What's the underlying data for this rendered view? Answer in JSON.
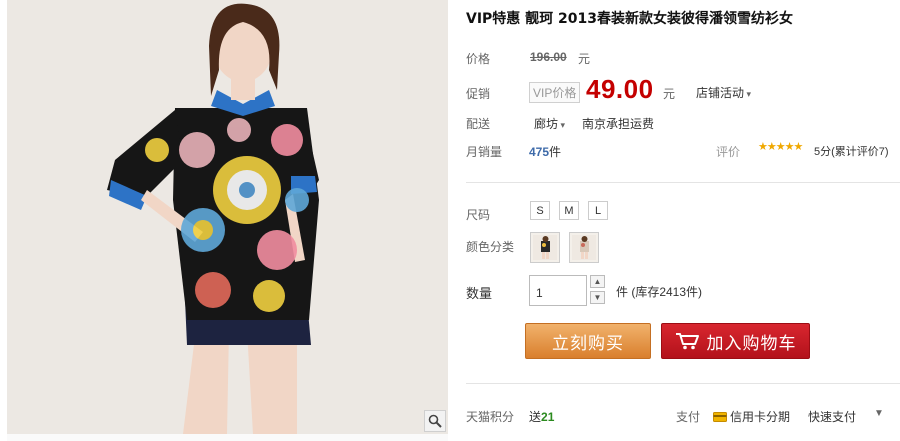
{
  "product": {
    "title": "VIP特惠 靓珂 2013春装新款女装彼得潘领雪纺衫女"
  },
  "price": {
    "label": "价格",
    "original": "196.00",
    "currency": "元",
    "promo_label": "促销",
    "vip_tag": "VIP价格",
    "promo": "49.00",
    "shop_event": "店铺活动"
  },
  "shipping": {
    "label": "配送",
    "from": "廊坊",
    "note": "南京承担运费"
  },
  "sales": {
    "label": "月销量",
    "count": "475",
    "unit": "件",
    "review_label": "评价",
    "stars": "★★★★★",
    "rating_text": "5分(累计评价7)"
  },
  "options": {
    "size_label": "尺码",
    "sizes": [
      "S",
      "M",
      "L"
    ],
    "color_label": "颜色分类"
  },
  "quantity": {
    "label": "数量",
    "value": "1",
    "stock_note": "件 (库存2413件)"
  },
  "actions": {
    "buy_now": "立刻购买",
    "add_to_cart": "加入购物车"
  },
  "footer": {
    "points_label": "天猫积分",
    "points_prefix": "送",
    "points_value": "21",
    "pay_label": "支付",
    "pay_credit": "信用卡分期",
    "pay_quick": "快速支付"
  },
  "colors": {
    "price_red": "#c40000",
    "buy_orange": "#d97f2d",
    "cart_red": "#b3121b",
    "star_gold": "#f0a800"
  },
  "icons": {
    "zoom": "magnifier-icon",
    "cart": "shopping-cart-icon",
    "card": "credit-card-icon"
  }
}
